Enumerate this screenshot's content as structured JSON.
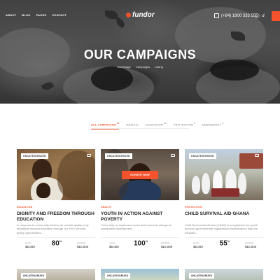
{
  "nav": {
    "links": [
      "ABOUT",
      "BLOG",
      "PAGES",
      "CONTACT"
    ],
    "logo": "fundor",
    "phone": "(+84) 1800 333 555",
    "icons": [
      "user-icon",
      "search-icon",
      "cart-icon",
      "menu-icon"
    ],
    "accent": "#f4522d"
  },
  "hero": {
    "title": "OUR CAMPAIGNS",
    "breadcrumb": [
      "Homepage",
      "Campaigns",
      "Listing"
    ]
  },
  "filters": [
    {
      "label": "ALL CAMPAIGNS",
      "count": "12",
      "active": true
    },
    {
      "label": "HEALTH",
      "count": "",
      "active": false
    },
    {
      "label": "EDUCATION",
      "count": "22",
      "active": false
    },
    {
      "label": "PROTECTION",
      "count": "5",
      "active": false
    },
    {
      "label": "EMERGENCY",
      "count": "8",
      "active": false
    }
  ],
  "campaigns": [
    {
      "badge": "UNCATEGORIZED",
      "category": "EDUCATION",
      "title": "DIGNITY AND FREEDOM THROUGH EDUCATION",
      "desc": "In response to community leaders we provide quality, truly affordable medium education through our 100+ schools, giving opportunities...",
      "goal_label": "GOAL",
      "goal": "$5,000",
      "percent": "80",
      "raised_label": "RAISED",
      "raised": "$10,000"
    },
    {
      "badge": "UNCATEGORIZED",
      "category": "HEALTH",
      "title": "YOUTH IN ACTION AGAINST POVERTY",
      "desc": "Come help us implement social and economic change for sustainable development...",
      "donate": "DONATE NOW",
      "goal_label": "GOAL",
      "goal": "$5,000",
      "percent": "100",
      "raised_label": "RAISED",
      "raised": "$10,000"
    },
    {
      "badge": "UNCATEGORIZED",
      "category": "PROTECTION",
      "title": "CHILD SURVIVAL AID GHANA",
      "desc": "Child Survival Aid Ghana (CSAG) is a registered non-profit and non-governmental organization established to help the educatio...",
      "goal_label": "GOAL",
      "goal": "$5,000",
      "percent": "55",
      "raised_label": "RAISED",
      "raised": "$10,000"
    }
  ],
  "more": [
    {
      "badge": "UNCATEGORIZED"
    },
    {
      "badge": "UNCATEGORIZED"
    },
    {
      "badge": "UNCATEGORIZED"
    }
  ]
}
